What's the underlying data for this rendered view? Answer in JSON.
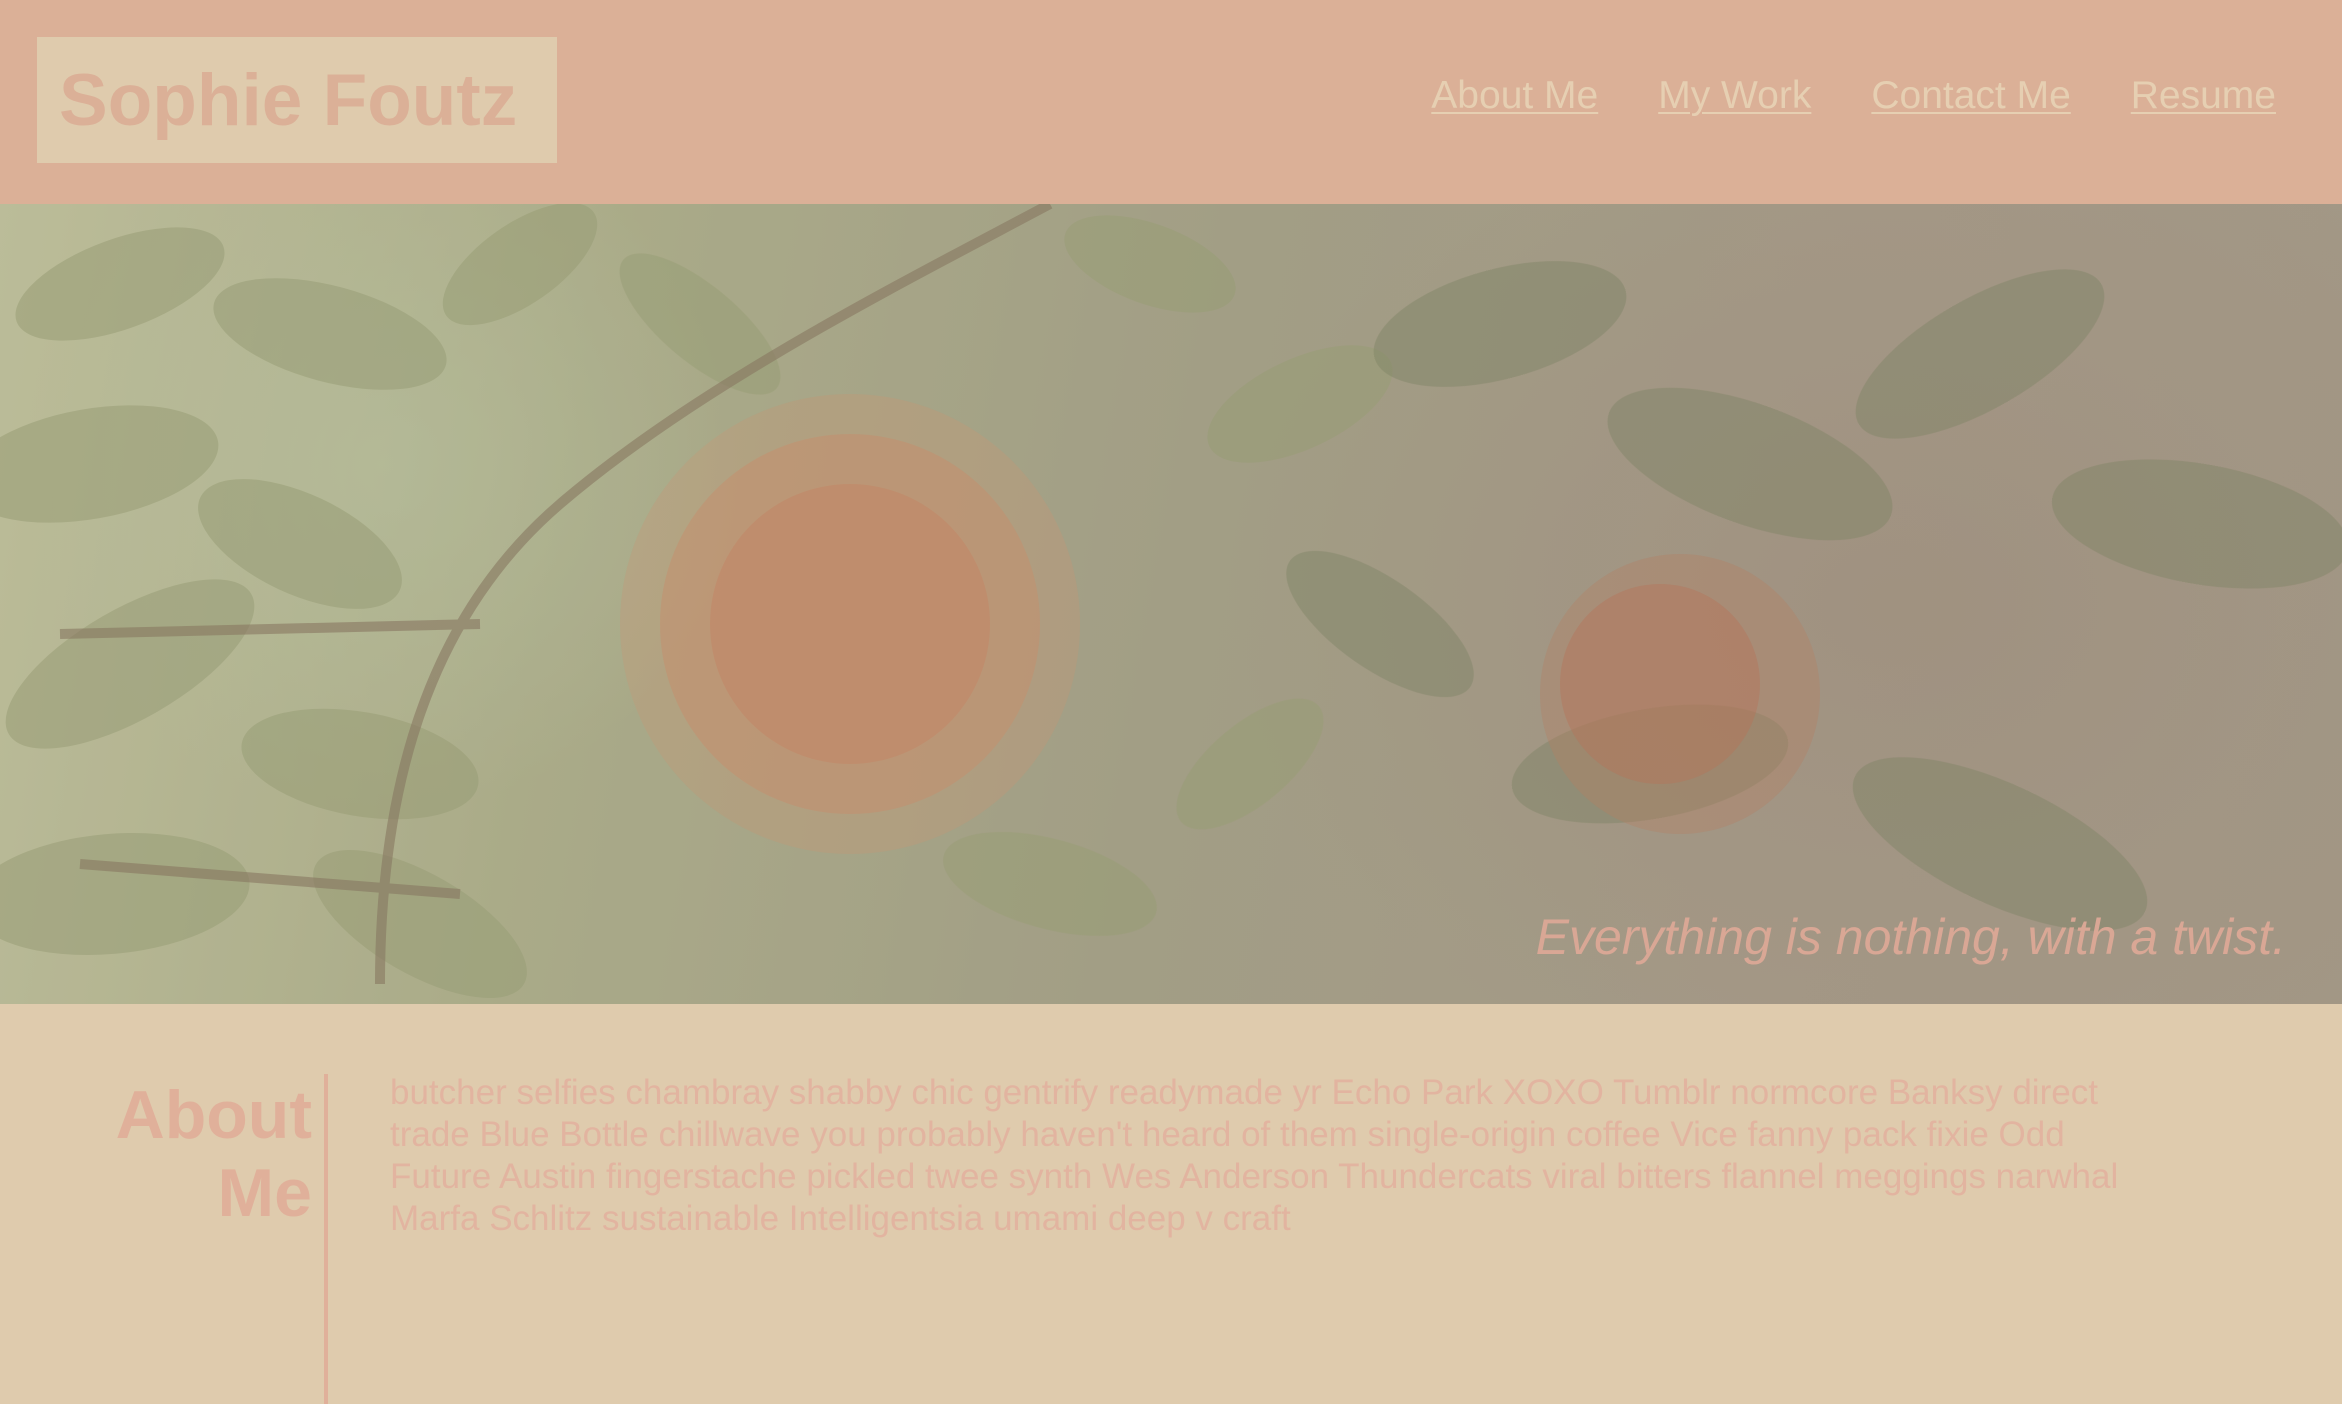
{
  "header": {
    "logo_text": "Sophie Foutz",
    "nav": [
      {
        "label": "About Me"
      },
      {
        "label": "My Work"
      },
      {
        "label": "Contact Me"
      },
      {
        "label": "Resume"
      }
    ]
  },
  "hero": {
    "tagline": "Everything is nothing, with a twist."
  },
  "about": {
    "title_line1": "About",
    "title_line2": "Me",
    "body": "butcher selfies chambray shabby chic gentrify readymade yr Echo Park XOXO Tumblr normcore Banksy direct trade Blue Bottle chillwave you probably haven't heard of them single-origin coffee Vice fanny pack fixie Odd Future Austin fingerstache pickled twee synth Wes Anderson Thundercats viral bitters flannel meggings narwhal Marfa Schlitz sustainable Intelligentsia umami deep v craft"
  },
  "colors": {
    "header_bg": "#dbb097",
    "page_bg": "#dfcbad",
    "accent": "#e0b09a"
  }
}
